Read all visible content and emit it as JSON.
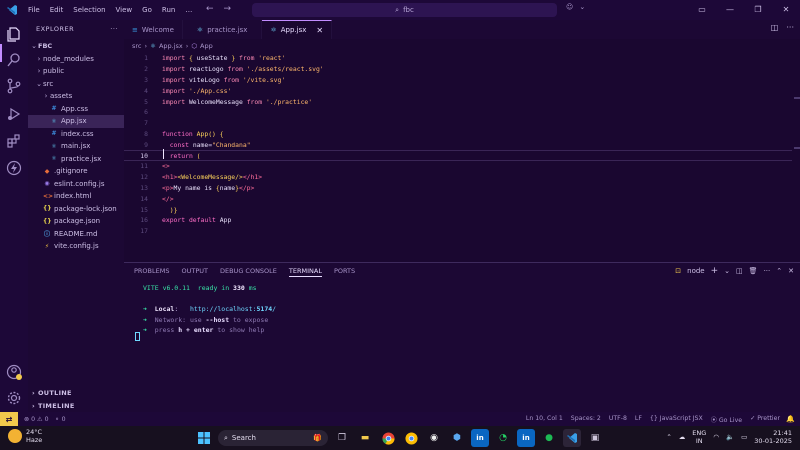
{
  "titlebar": {
    "menu": [
      "File",
      "Edit",
      "Selection",
      "View",
      "Go",
      "Run",
      "…"
    ],
    "search_text": "fbc"
  },
  "explorer": {
    "header": "EXPLORER",
    "more": "···",
    "root": "FBC",
    "items": [
      {
        "label": "node_modules",
        "kind": "folder",
        "indent": 1,
        "chev": "›",
        "icon": ""
      },
      {
        "label": "public",
        "kind": "folder",
        "indent": 1,
        "chev": "›",
        "icon": ""
      },
      {
        "label": "src",
        "kind": "folder-open",
        "indent": 1,
        "chev": "⌄",
        "icon": ""
      },
      {
        "label": "assets",
        "kind": "folder",
        "indent": 2,
        "chev": "›",
        "icon": ""
      },
      {
        "label": "App.css",
        "kind": "css",
        "indent": 2,
        "chev": "",
        "icon": "#"
      },
      {
        "label": "App.jsx",
        "kind": "jsx",
        "indent": 2,
        "chev": "",
        "icon": "⚛",
        "selected": true
      },
      {
        "label": "index.css",
        "kind": "css",
        "indent": 2,
        "chev": "",
        "icon": "#"
      },
      {
        "label": "main.jsx",
        "kind": "jsx",
        "indent": 2,
        "chev": "",
        "icon": "⚛"
      },
      {
        "label": "practice.jsx",
        "kind": "jsx",
        "indent": 2,
        "chev": "",
        "icon": "⚛"
      },
      {
        "label": ".gitignore",
        "kind": "git",
        "indent": 1,
        "chev": "",
        "icon": "◆"
      },
      {
        "label": "eslint.config.js",
        "kind": "eslint",
        "indent": 1,
        "chev": "",
        "icon": "◉"
      },
      {
        "label": "index.html",
        "kind": "html",
        "indent": 1,
        "chev": "",
        "icon": "<>"
      },
      {
        "label": "package-lock.json",
        "kind": "json",
        "indent": 1,
        "chev": "",
        "icon": "{}"
      },
      {
        "label": "package.json",
        "kind": "json",
        "indent": 1,
        "chev": "",
        "icon": "{}"
      },
      {
        "label": "README.md",
        "kind": "md",
        "indent": 1,
        "chev": "",
        "icon": "ⓘ"
      },
      {
        "label": "vite.config.js",
        "kind": "vite",
        "indent": 1,
        "chev": "",
        "icon": "⚡"
      }
    ],
    "outline": "OUTLINE",
    "timeline": "TIMELINE"
  },
  "tabs": [
    {
      "label": "Welcome",
      "icon": "≡",
      "active": false
    },
    {
      "label": "practice.jsx",
      "icon": "⚛",
      "active": false
    },
    {
      "label": "App.jsx",
      "icon": "⚛",
      "active": true,
      "close": "✕"
    }
  ],
  "breadcrumb": [
    "src",
    "App.jsx",
    "App"
  ],
  "code_lines": [
    {
      "n": "1",
      "html": "<span class='k-imp'>import</span> <span class='k-br'>{</span> <span class='k-id'>useState</span> <span class='k-br'>}</span> <span class='k-imp'>from</span> <span class='k-str'>'react'</span>"
    },
    {
      "n": "2",
      "html": "<span class='k-imp'>import</span> <span class='k-id'>reactLogo</span> <span class='k-imp'>from</span> <span class='k-str'>'./assets/react.svg'</span>"
    },
    {
      "n": "3",
      "html": "<span class='k-imp'>import</span> <span class='k-id'>viteLogo</span> <span class='k-imp'>from</span> <span class='k-str'>'/vite.svg'</span>"
    },
    {
      "n": "4",
      "html": "<span class='k-imp'>import</span> <span class='k-str'>'./App.css'</span>"
    },
    {
      "n": "5",
      "html": "<span class='k-imp'>import</span> <span class='k-id'>WelcomeMessage</span> <span class='k-imp'>from</span> <span class='k-str'>'./practice'</span>"
    },
    {
      "n": "6",
      "html": ""
    },
    {
      "n": "7",
      "html": ""
    },
    {
      "n": "8",
      "html": "<span class='k-kw'>function</span> <span class='k-fn'>App</span><span class='k-br'>()</span> <span class='k-br'>{</span>"
    },
    {
      "n": "9",
      "html": "  <span class='k-kw'>const</span> <span class='k-id'>name</span>=<span class='k-str'>\"Chandana\"</span>"
    },
    {
      "n": "10",
      "html": "  <span class='k-kw'>return</span> <span class='k-br'>(</span>",
      "current": true
    },
    {
      "n": "11",
      "html": "<span class='k-tag'>&lt;&gt;</span>"
    },
    {
      "n": "12",
      "html": "<span class='k-tag'>&lt;h1&gt;</span><span class='k-comp'>&lt;WelcomeMessage/&gt;</span><span class='k-tag'>&lt;/h1&gt;</span>"
    },
    {
      "n": "13",
      "html": "<span class='k-tag'>&lt;p&gt;</span><span class='k-id'>My name is </span><span class='k-br'>{</span><span class='k-id'>name</span><span class='k-br'>}</span><span class='k-tag'>&lt;/p&gt;</span>"
    },
    {
      "n": "14",
      "html": "<span class='k-tag'>&lt;/&gt;</span>"
    },
    {
      "n": "15",
      "html": "  <span class='k-br'>)</span><span class='k-br'>}</span>"
    },
    {
      "n": "16",
      "html": "<span class='k-kw'>export</span> <span class='k-kw'>default</span> <span class='k-id'>App</span>"
    },
    {
      "n": "17",
      "html": ""
    }
  ],
  "panel": {
    "tabs": [
      "PROBLEMS",
      "OUTPUT",
      "DEBUG CONSOLE",
      "TERMINAL",
      "PORTS"
    ],
    "active_tab": "TERMINAL",
    "terminal_name": "node",
    "terminal_lines": [
      "<span class='t-green'>VITE v6.0.11</span>  <span class='t-green'>ready in</span> <span class='t-white'>330</span> <span class='t-green'>ms</span>",
      "",
      "<span class='t-green'>➜</span>  <span class='t-white'>Local</span>:   <span class='t-cyan'>http://localhost:<b>5174</b>/</span>",
      "<span class='t-green'>➜</span>  <span class='t-muted'>Network: use </span><span class='t-bold'>--host</span><span class='t-muted'> to expose</span>",
      "<span class='t-green'>➜</span>  <span class='t-muted'>press </span><span class='t-bold'>h + enter</span><span class='t-muted'> to show help</span>"
    ]
  },
  "status": {
    "left": [
      "⊗ 0 ⚠ 0",
      "⚬ 0"
    ],
    "right": [
      "Ln 10, Col 1",
      "Spaces: 2",
      "UTF-8",
      "LF",
      "{} JavaScript JSX",
      "⦿ Go Live",
      "✓ Prettier"
    ],
    "bell": "🔔"
  },
  "taskbar": {
    "temp": "24°C",
    "weather": "Haze",
    "search": "Search",
    "lang1": "ENG",
    "lang2": "IN",
    "time": "21:41",
    "date": "30-01-2025"
  }
}
